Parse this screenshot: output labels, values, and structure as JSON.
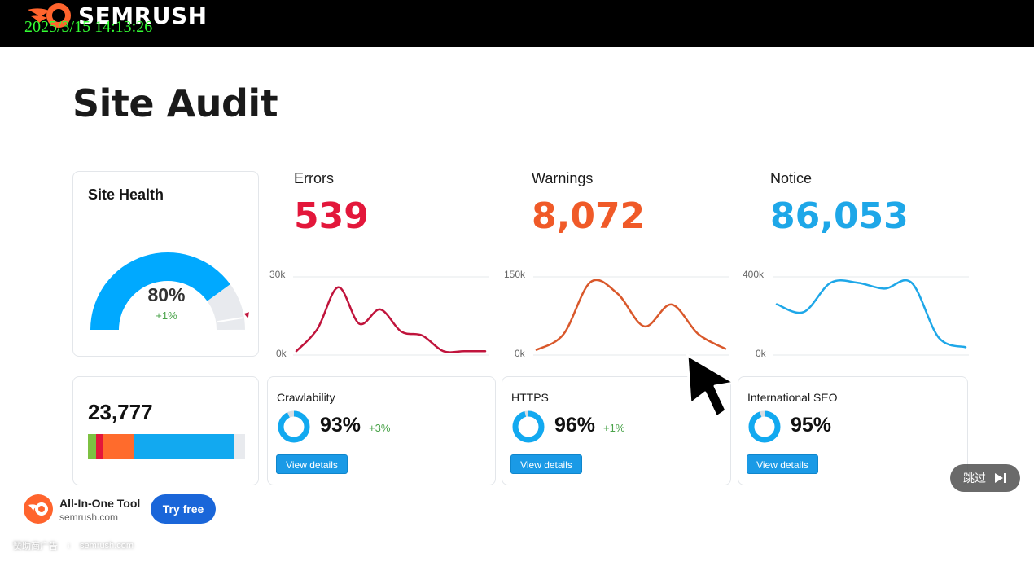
{
  "header": {
    "brand": "SEMRUSH",
    "timestamp": "2025/3/15 14:13:26",
    "logo_icon": "semrush-fire-icon"
  },
  "page": {
    "title": "Site Audit"
  },
  "site_health": {
    "title": "Site Health",
    "value": "80%",
    "delta": "+1%",
    "fraction": 0.8,
    "colors": {
      "fill": "#00a9ff",
      "rest": "#e8eaee",
      "marker": "#c0143c"
    }
  },
  "metrics": [
    {
      "label": "Errors",
      "value": "539",
      "color": "#e3173b",
      "ymax_label": "30k",
      "ymin_label": "0k"
    },
    {
      "label": "Warnings",
      "value": "8,072",
      "color": "#f05a28",
      "ymax_label": "150k",
      "ymin_label": "0k"
    },
    {
      "label": "Notice",
      "value": "86,053",
      "color": "#1ea7e8",
      "ymax_label": "400k",
      "ymin_label": "0k"
    }
  ],
  "chart_data": [
    {
      "type": "line",
      "ylim": [
        0,
        30000
      ],
      "series": [
        {
          "values": [
            1500,
            10000,
            26000,
            12000,
            17500,
            9000,
            7500,
            1500,
            1500,
            1500
          ]
        }
      ],
      "tick_labels": [
        "0k",
        "30k"
      ],
      "color": "#c0143c"
    },
    {
      "type": "line",
      "ylim": [
        0,
        150000
      ],
      "series": [
        {
          "values": [
            10000,
            40000,
            140000,
            118000,
            55000,
            97000,
            40000,
            12000
          ]
        }
      ],
      "tick_labels": [
        "0k",
        "150k"
      ],
      "color": "#d9582b"
    },
    {
      "type": "line",
      "ylim": [
        0,
        400000
      ],
      "series": [
        {
          "values": [
            260000,
            220000,
            370000,
            370000,
            340000,
            370000,
            90000,
            40000
          ]
        }
      ],
      "tick_labels": [
        "0k",
        "400k"
      ],
      "color": "#1ea7e8"
    }
  ],
  "pages": {
    "count": "23,777",
    "segments": [
      {
        "color": "#7dc142",
        "share": 0.05
      },
      {
        "color": "#e3173b",
        "share": 0.05
      },
      {
        "color": "#ff6b2c",
        "share": 0.19
      },
      {
        "color": "#12a9f0",
        "share": 0.64
      },
      {
        "color": "#e8eaee",
        "share": 0.07
      }
    ]
  },
  "checks": [
    {
      "title": "Crawlability",
      "value": "93%",
      "delta": "+3%",
      "fraction": 0.93,
      "button": "View details"
    },
    {
      "title": "HTTPS",
      "value": "96%",
      "delta": "+1%",
      "fraction": 0.96,
      "button": "View details"
    },
    {
      "title": "International SEO",
      "value": "95%",
      "delta": "",
      "fraction": 0.95,
      "button": "View details"
    }
  ],
  "overlay": {
    "skip_label": "跳过",
    "skip_icon": "skip-next-icon",
    "cursor_icon": "mouse-pointer-icon"
  },
  "ad": {
    "title": "All-In-One Tool",
    "domain": "semrush.com",
    "cta": "Try free",
    "sponsor_label": "赞助商广告",
    "sponsor_domain": "semrush.com"
  }
}
